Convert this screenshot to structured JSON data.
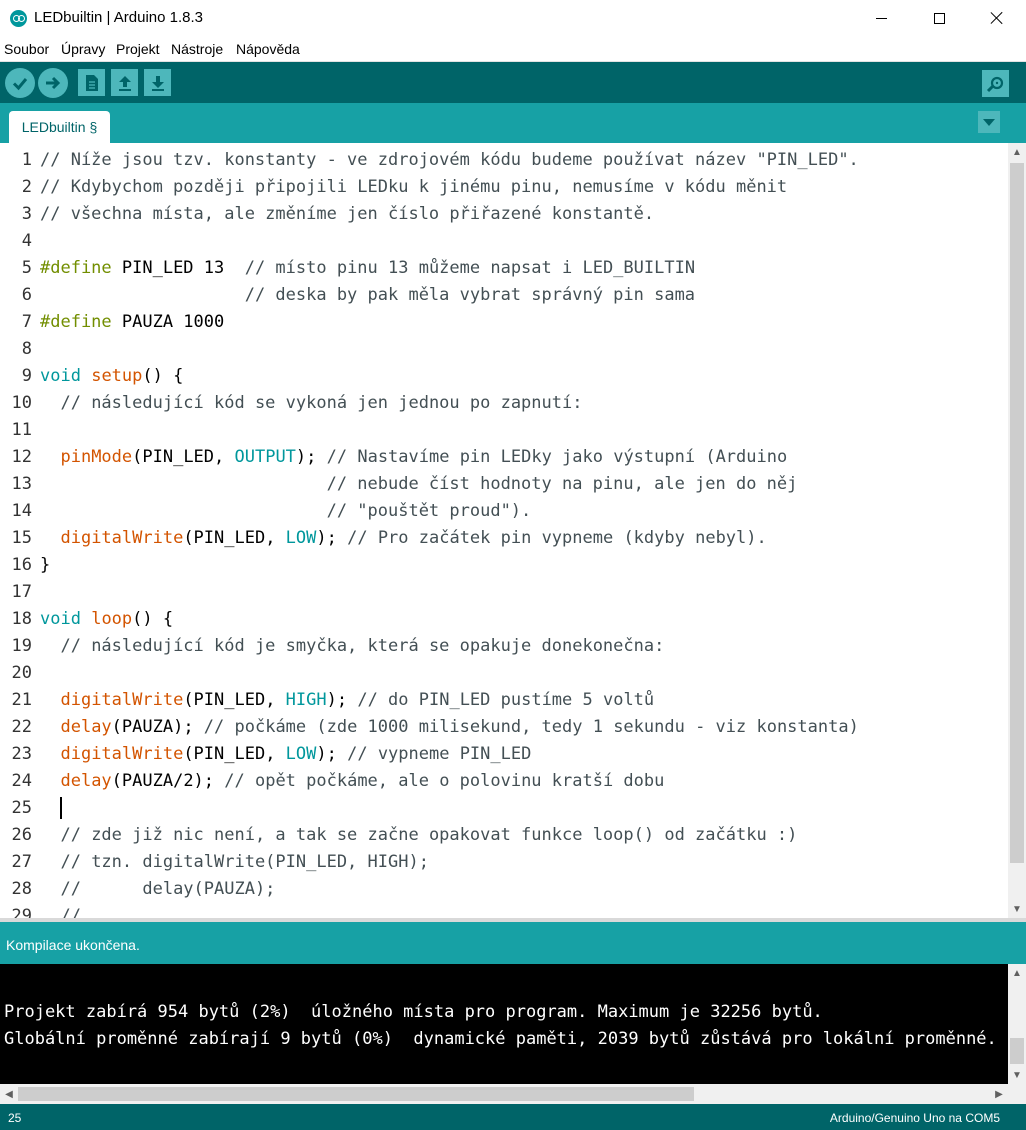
{
  "window": {
    "title": "LEDbuiltin | Arduino 1.8.3"
  },
  "menu": [
    "Soubor",
    "Úpravy",
    "Projekt",
    "Nástroje",
    "Nápověda"
  ],
  "toolbar": {
    "buttons": [
      "verify-icon",
      "upload-icon",
      "new-icon",
      "open-icon",
      "save-icon"
    ],
    "serial_monitor": "serial-monitor-icon"
  },
  "tab": {
    "label": "LEDbuiltin §"
  },
  "editor": {
    "line_numbers": [
      "1",
      "2",
      "3",
      "4",
      "5",
      "6",
      "7",
      "8",
      "9",
      "10",
      "11",
      "12",
      "13",
      "14",
      "15",
      "16",
      "17",
      "18",
      "19",
      "20",
      "21",
      "22",
      "23",
      "24",
      "25",
      "26",
      "27",
      "28",
      "29"
    ],
    "lines": [
      [
        {
          "t": "// Níže jsou tzv. konstanty - ve zdrojovém kódu budeme používat název \"PIN_LED\".",
          "c": "cmt"
        }
      ],
      [
        {
          "t": "// Kdybychom později připojili LEDku k jinému pinu, nemusíme v kódu měnit",
          "c": "cmt"
        }
      ],
      [
        {
          "t": "// všechna místa, ale změníme jen číslo přiřazené konstantě.",
          "c": "cmt"
        }
      ],
      [],
      [
        {
          "t": "#define",
          "c": "pp"
        },
        {
          "t": " PIN_LED 13  ",
          "c": ""
        },
        {
          "t": "// místo pinu 13 můžeme napsat i LED_BUILTIN",
          "c": "cmt"
        }
      ],
      [
        {
          "t": "                    ",
          "c": ""
        },
        {
          "t": "// deska by pak měla vybrat správný pin sama",
          "c": "cmt"
        }
      ],
      [
        {
          "t": "#define",
          "c": "pp"
        },
        {
          "t": " PAUZA 1000",
          "c": ""
        }
      ],
      [],
      [
        {
          "t": "void",
          "c": "kw"
        },
        {
          "t": " ",
          "c": ""
        },
        {
          "t": "setup",
          "c": "fn"
        },
        {
          "t": "() {",
          "c": ""
        }
      ],
      [
        {
          "t": "  ",
          "c": ""
        },
        {
          "t": "// následující kód se vykoná jen jednou po zapnutí:",
          "c": "cmt"
        }
      ],
      [],
      [
        {
          "t": "  ",
          "c": ""
        },
        {
          "t": "pinMode",
          "c": "fn"
        },
        {
          "t": "(PIN_LED, ",
          "c": ""
        },
        {
          "t": "OUTPUT",
          "c": "kw"
        },
        {
          "t": "); ",
          "c": ""
        },
        {
          "t": "// Nastavíme pin LEDky jako výstupní (Arduino",
          "c": "cmt"
        }
      ],
      [
        {
          "t": "                            ",
          "c": ""
        },
        {
          "t": "// nebude číst hodnoty na pinu, ale jen do něj",
          "c": "cmt"
        }
      ],
      [
        {
          "t": "                            ",
          "c": ""
        },
        {
          "t": "// \"pouštět proud\").",
          "c": "cmt"
        }
      ],
      [
        {
          "t": "  ",
          "c": ""
        },
        {
          "t": "digitalWrite",
          "c": "fn"
        },
        {
          "t": "(PIN_LED, ",
          "c": ""
        },
        {
          "t": "LOW",
          "c": "kw"
        },
        {
          "t": "); ",
          "c": ""
        },
        {
          "t": "// Pro začátek pin vypneme (kdyby nebyl).",
          "c": "cmt"
        }
      ],
      [
        {
          "t": "}",
          "c": ""
        }
      ],
      [],
      [
        {
          "t": "void",
          "c": "kw"
        },
        {
          "t": " ",
          "c": ""
        },
        {
          "t": "loop",
          "c": "fn"
        },
        {
          "t": "() {",
          "c": ""
        }
      ],
      [
        {
          "t": "  ",
          "c": ""
        },
        {
          "t": "// následující kód je smyčka, která se opakuje donekonečna:",
          "c": "cmt"
        }
      ],
      [],
      [
        {
          "t": "  ",
          "c": ""
        },
        {
          "t": "digitalWrite",
          "c": "fn"
        },
        {
          "t": "(PIN_LED, ",
          "c": ""
        },
        {
          "t": "HIGH",
          "c": "kw"
        },
        {
          "t": "); ",
          "c": ""
        },
        {
          "t": "// do PIN_LED pustíme 5 voltů",
          "c": "cmt"
        }
      ],
      [
        {
          "t": "  ",
          "c": ""
        },
        {
          "t": "delay",
          "c": "fn"
        },
        {
          "t": "(PAUZA); ",
          "c": ""
        },
        {
          "t": "// počkáme (zde 1000 milisekund, tedy 1 sekundu - viz konstanta)",
          "c": "cmt"
        }
      ],
      [
        {
          "t": "  ",
          "c": ""
        },
        {
          "t": "digitalWrite",
          "c": "fn"
        },
        {
          "t": "(PIN_LED, ",
          "c": ""
        },
        {
          "t": "LOW",
          "c": "kw"
        },
        {
          "t": "); ",
          "c": ""
        },
        {
          "t": "// vypneme PIN_LED",
          "c": "cmt"
        }
      ],
      [
        {
          "t": "  ",
          "c": ""
        },
        {
          "t": "delay",
          "c": "fn"
        },
        {
          "t": "(PAUZA/2); ",
          "c": ""
        },
        {
          "t": "// opět počkáme, ale o polovinu kratší dobu",
          "c": "cmt"
        }
      ],
      [
        {
          "t": "  ",
          "c": ""
        },
        {
          "t": "",
          "c": "caret"
        }
      ],
      [
        {
          "t": "  ",
          "c": ""
        },
        {
          "t": "// zde již nic není, a tak se začne opakovat funkce loop() od začátku :)",
          "c": "cmt"
        }
      ],
      [
        {
          "t": "  ",
          "c": ""
        },
        {
          "t": "// tzn. digitalWrite(PIN_LED, HIGH);",
          "c": "cmt"
        }
      ],
      [
        {
          "t": "  ",
          "c": ""
        },
        {
          "t": "//      delay(PAUZA);",
          "c": "cmt"
        }
      ],
      [
        {
          "t": "  ",
          "c": ""
        },
        {
          "t": "//",
          "c": "cmt"
        }
      ]
    ]
  },
  "status": {
    "message": "Kompilace ukončena."
  },
  "console": {
    "lines": [
      "Projekt zabírá 954 bytů (2%)  úložného místa pro program. Maximum je 32256 bytů.",
      "Globální proměnné zabírají 9 bytů (0%)  dynamické paměti, 2039 bytů zůstává pro lokální proměnné."
    ]
  },
  "footer": {
    "line": "25",
    "board": "Arduino/Genuino Uno na COM5"
  },
  "colors": {
    "toolbar": "#006468",
    "tabbar": "#17a1a5",
    "button": "#4db7bb",
    "keyword": "#00979c",
    "function": "#d35400",
    "preprocessor": "#728e00"
  }
}
